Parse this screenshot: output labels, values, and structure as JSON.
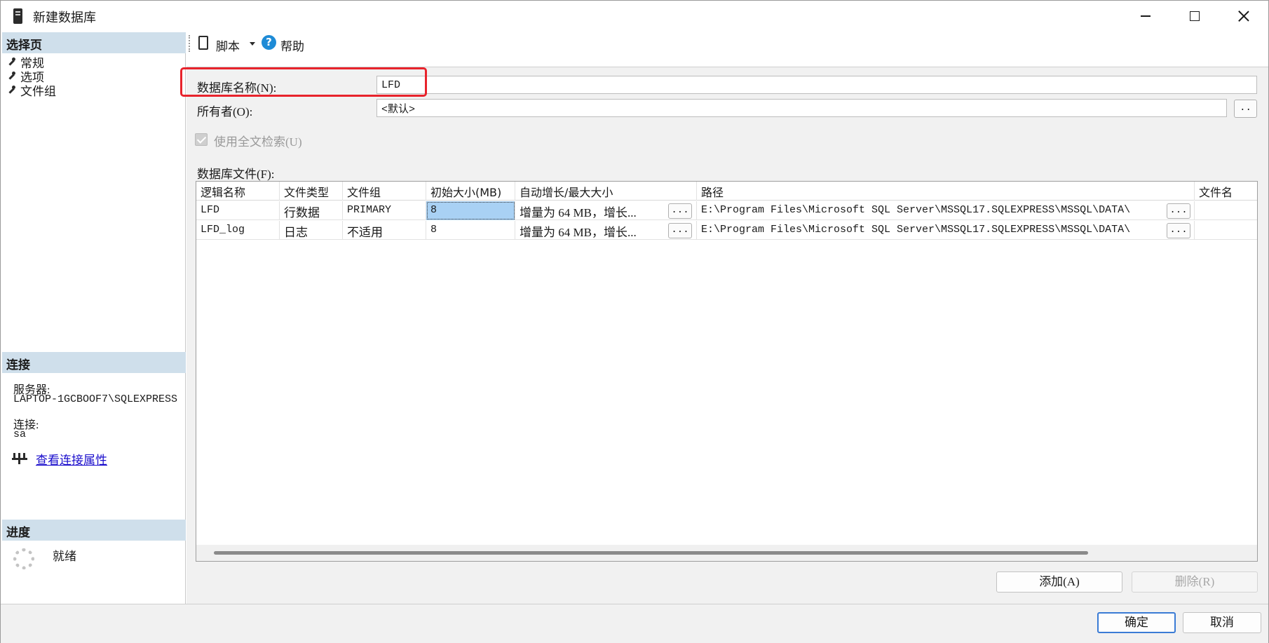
{
  "window": {
    "title": "新建数据库"
  },
  "left": {
    "select_page_header": "选择页",
    "nav_items": [
      {
        "label": "常规"
      },
      {
        "label": "选项"
      },
      {
        "label": "文件组"
      }
    ],
    "connection_header": "连接",
    "server_label": "服务器:",
    "server_value": "LAPTOP-1GCBOOF7\\SQLEXPRESS",
    "connection_label": "连接:",
    "connection_value": "sa",
    "view_props_link": "查看连接属性",
    "progress_header": "进度",
    "progress_status": "就绪"
  },
  "toolbar": {
    "script_label": "脚本",
    "help_label": "帮助",
    "help_glyph": "?"
  },
  "form": {
    "db_name_label": "数据库名称(N):",
    "db_name_value": "LFD",
    "owner_label": "所有者(O):",
    "owner_value": "<默认>",
    "owner_browse": "..",
    "fulltext_label": "使用全文检索(U)",
    "files_label": "数据库文件(F):"
  },
  "grid": {
    "columns": [
      "逻辑名称",
      "文件类型",
      "文件组",
      "初始大小(MB)",
      "自动增长/最大大小",
      "路径",
      "文件名"
    ],
    "rows": [
      {
        "logical": "LFD",
        "type": "行数据",
        "filegroup": "PRIMARY",
        "size": "8",
        "autogrow": "增量为 64 MB，增长...",
        "autogrow_btn": "...",
        "path": "E:\\Program Files\\Microsoft SQL Server\\MSSQL17.SQLEXPRESS\\MSSQL\\DATA\\",
        "path_btn": "...",
        "filename": ""
      },
      {
        "logical": "LFD_log",
        "type": "日志",
        "filegroup": "不适用",
        "size": "8",
        "autogrow": "增量为 64 MB，增长...",
        "autogrow_btn": "...",
        "path": "E:\\Program Files\\Microsoft SQL Server\\MSSQL17.SQLEXPRESS\\MSSQL\\DATA\\",
        "path_btn": "...",
        "filename": ""
      }
    ]
  },
  "buttons": {
    "add": "添加(A)",
    "remove": "删除(R)",
    "ok": "确定",
    "cancel": "取消"
  },
  "colors": {
    "highlight": "#e8232c",
    "section_header": "#cfdfeb",
    "selected_cell": "#a9d1f4",
    "link": "#1a0dcc"
  }
}
